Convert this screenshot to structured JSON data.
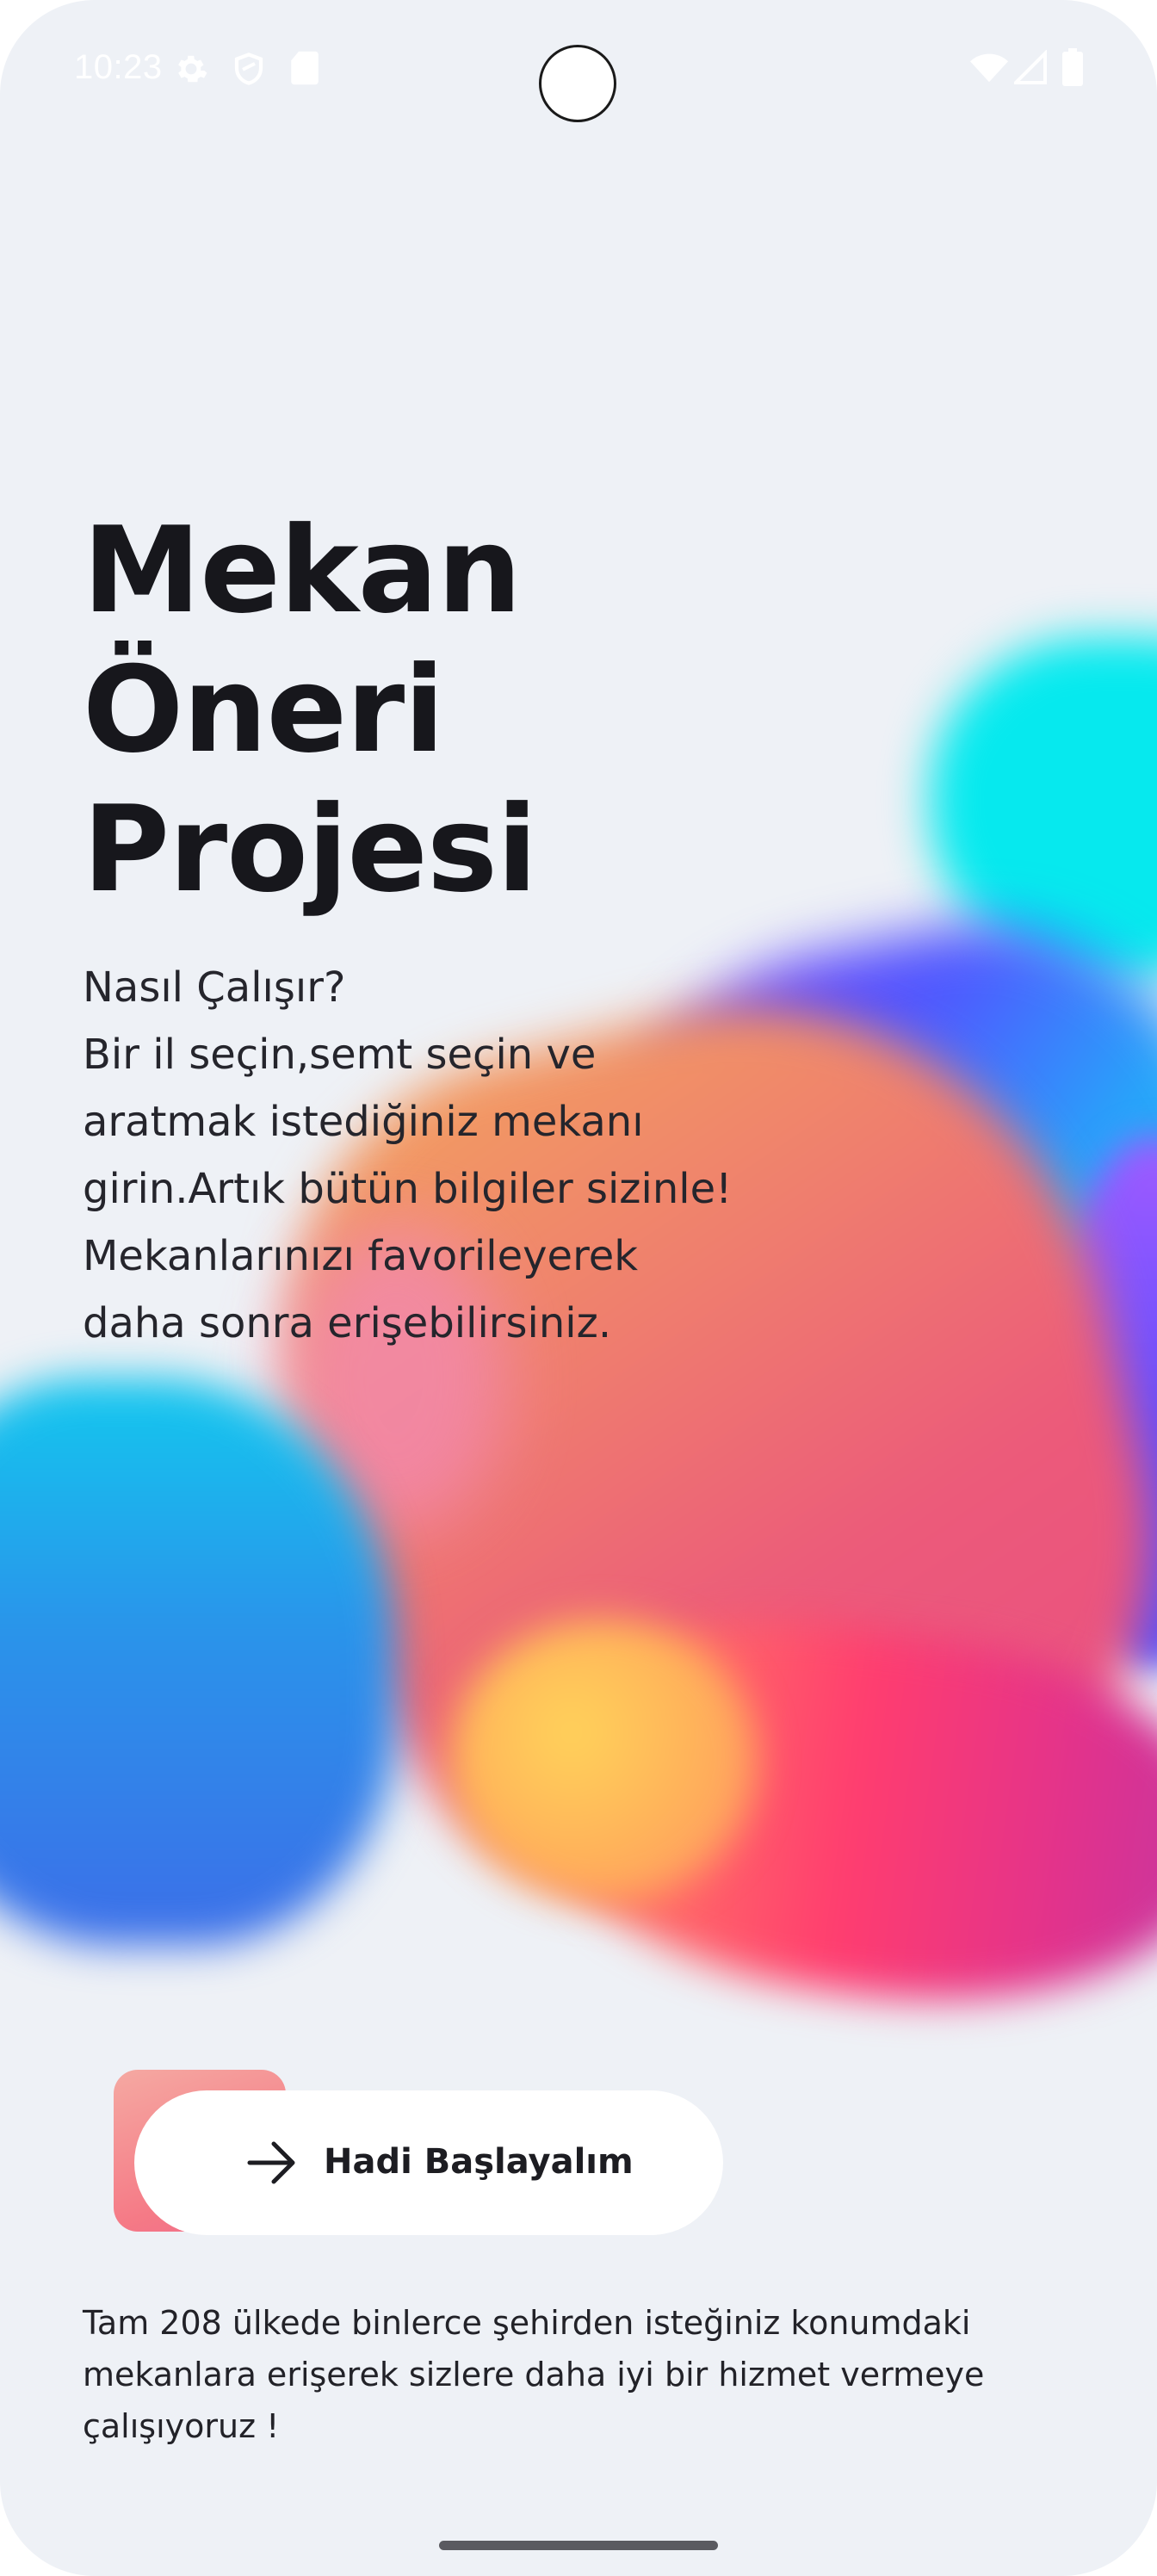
{
  "status_bar": {
    "time": "10:23",
    "left_icons": [
      "gear-icon",
      "shield-icon",
      "sd-card-icon"
    ],
    "right_icons": [
      "wifi-icon",
      "signal-icon",
      "battery-icon"
    ]
  },
  "title": {
    "lines": [
      "Mekan",
      "Öneri",
      "Projesi"
    ]
  },
  "description": {
    "lines": [
      "Nasıl Çalışır?",
      "Bir il seçin,semt seçin ve",
      "aratmak istediğiniz mekanı",
      "girin.Artık bütün bilgiler sizinle!",
      "Mekanlarınızı favorileyerek",
      "daha sonra erişebilirsiniz."
    ]
  },
  "cta": {
    "label": "Hadi Başlayalım",
    "icon": "arrow-right-icon"
  },
  "footer": {
    "lines": [
      "Tam 208 ülkede binlerce şehirden isteğiniz konumdaki",
      "mekanlara erişerek sizlere daha iyi bir hizmet vermeye",
      "çalışıyoruz !"
    ]
  },
  "colors": {
    "background": "#eef1f6",
    "text_primary": "#17171c",
    "button_bg": "#ffffff",
    "button_accent": "#f57a86",
    "blob_cyan": "#06e9ee",
    "blob_violet": "#7a28f5",
    "blob_orange": "#ef7e6e",
    "blob_blue": "#2a93ea",
    "blob_magenta": "#ff3d6f",
    "blob_yellow": "#ffd35a"
  }
}
